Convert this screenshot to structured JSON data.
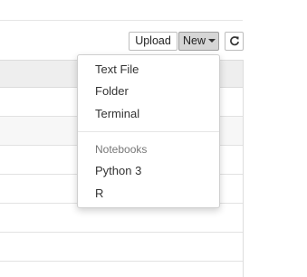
{
  "toolbar": {
    "upload_label": "Upload",
    "new_label": "New",
    "refresh_icon": "refresh-icon"
  },
  "new_menu": {
    "items": [
      {
        "label": "Text File"
      },
      {
        "label": "Folder"
      },
      {
        "label": "Terminal"
      }
    ],
    "section_header": "Notebooks",
    "notebooks": [
      {
        "label": "Python 3"
      },
      {
        "label": "R"
      }
    ]
  },
  "colors": {
    "new_button_bg": "#d6d6d6",
    "list_header_bg": "#eeeeee",
    "row_alt_bg": "#f7f7f7"
  }
}
